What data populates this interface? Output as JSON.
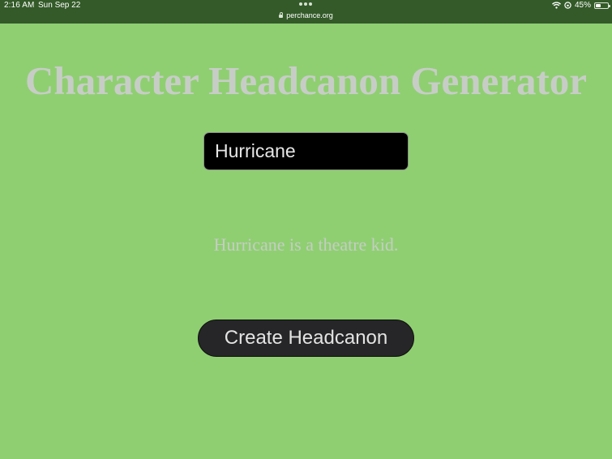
{
  "status_bar": {
    "time": "2:16 AM",
    "date": "Sun Sep 22",
    "url": "perchance.org",
    "battery_percent": "45%",
    "battery_level": 0.45,
    "icons": [
      "wifi-icon",
      "orientation-lock-icon",
      "battery-icon",
      "lock-icon",
      "more-dots-icon"
    ]
  },
  "page": {
    "title": "Character Headcanon Generator",
    "name_input_value": "Hurricane",
    "result": "Hurricane is a theatre kid.",
    "create_button_label": "Create Headcanon"
  },
  "colors": {
    "background": "#8fcf72",
    "status_bar": "#335a28",
    "title_text": "#c7cdc6",
    "input_background": "#000000",
    "button_background": "#262628"
  }
}
